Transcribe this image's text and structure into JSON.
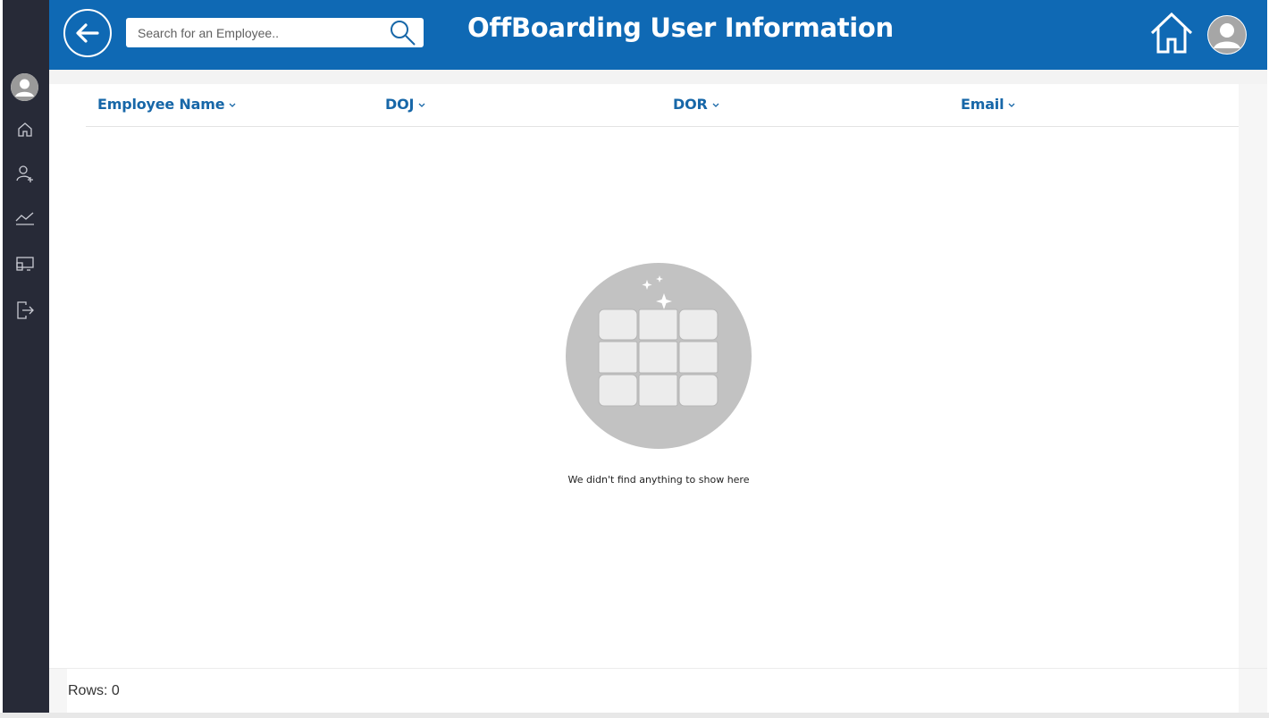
{
  "header": {
    "title": "OffBoarding User Information",
    "search_placeholder": "Search for an Employee..",
    "brand_color": "#0f69b4"
  },
  "sidebar": {
    "background": "#272a37",
    "items": [
      {
        "icon": "home-icon"
      },
      {
        "icon": "add-user-icon"
      },
      {
        "icon": "trend-chart-icon"
      },
      {
        "icon": "screen-layout-icon"
      },
      {
        "icon": "sign-out-icon"
      }
    ]
  },
  "table": {
    "columns": [
      "Employee Name",
      "DOJ",
      "DOR",
      "Email"
    ],
    "rows": []
  },
  "empty_state": {
    "message": "We didn't find anything to show here"
  },
  "footer": {
    "rows_label": "Rows: 0"
  }
}
